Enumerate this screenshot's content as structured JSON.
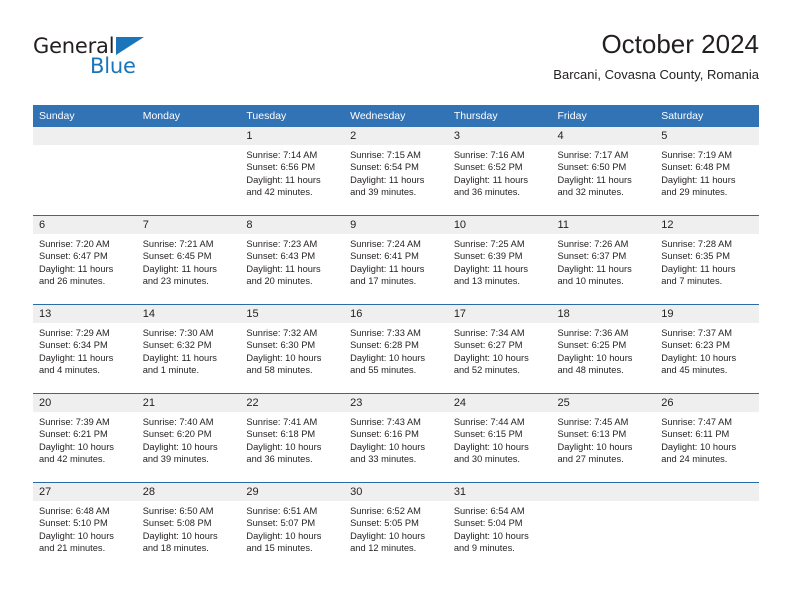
{
  "brand": {
    "name_top": "General",
    "name_bottom": "Blue",
    "color_blue": "#1b75bb",
    "color_dark": "#231f20",
    "triangle_icon": "triangle-icon"
  },
  "header": {
    "title": "October 2024",
    "subtitle": "Barcani, Covasna County, Romania"
  },
  "theme": {
    "header_blue": "#3273b5",
    "row_divider": "#2a6ca8",
    "daynum_bg": "#efefef"
  },
  "weekdays": [
    "Sunday",
    "Monday",
    "Tuesday",
    "Wednesday",
    "Thursday",
    "Friday",
    "Saturday"
  ],
  "weeks": [
    [
      {
        "day": "",
        "sunrise": "",
        "sunset": "",
        "daylight": ""
      },
      {
        "day": "",
        "sunrise": "",
        "sunset": "",
        "daylight": ""
      },
      {
        "day": "1",
        "sunrise": "Sunrise: 7:14 AM",
        "sunset": "Sunset: 6:56 PM",
        "daylight": "Daylight: 11 hours and 42 minutes."
      },
      {
        "day": "2",
        "sunrise": "Sunrise: 7:15 AM",
        "sunset": "Sunset: 6:54 PM",
        "daylight": "Daylight: 11 hours and 39 minutes."
      },
      {
        "day": "3",
        "sunrise": "Sunrise: 7:16 AM",
        "sunset": "Sunset: 6:52 PM",
        "daylight": "Daylight: 11 hours and 36 minutes."
      },
      {
        "day": "4",
        "sunrise": "Sunrise: 7:17 AM",
        "sunset": "Sunset: 6:50 PM",
        "daylight": "Daylight: 11 hours and 32 minutes."
      },
      {
        "day": "5",
        "sunrise": "Sunrise: 7:19 AM",
        "sunset": "Sunset: 6:48 PM",
        "daylight": "Daylight: 11 hours and 29 minutes."
      }
    ],
    [
      {
        "day": "6",
        "sunrise": "Sunrise: 7:20 AM",
        "sunset": "Sunset: 6:47 PM",
        "daylight": "Daylight: 11 hours and 26 minutes."
      },
      {
        "day": "7",
        "sunrise": "Sunrise: 7:21 AM",
        "sunset": "Sunset: 6:45 PM",
        "daylight": "Daylight: 11 hours and 23 minutes."
      },
      {
        "day": "8",
        "sunrise": "Sunrise: 7:23 AM",
        "sunset": "Sunset: 6:43 PM",
        "daylight": "Daylight: 11 hours and 20 minutes."
      },
      {
        "day": "9",
        "sunrise": "Sunrise: 7:24 AM",
        "sunset": "Sunset: 6:41 PM",
        "daylight": "Daylight: 11 hours and 17 minutes."
      },
      {
        "day": "10",
        "sunrise": "Sunrise: 7:25 AM",
        "sunset": "Sunset: 6:39 PM",
        "daylight": "Daylight: 11 hours and 13 minutes."
      },
      {
        "day": "11",
        "sunrise": "Sunrise: 7:26 AM",
        "sunset": "Sunset: 6:37 PM",
        "daylight": "Daylight: 11 hours and 10 minutes."
      },
      {
        "day": "12",
        "sunrise": "Sunrise: 7:28 AM",
        "sunset": "Sunset: 6:35 PM",
        "daylight": "Daylight: 11 hours and 7 minutes."
      }
    ],
    [
      {
        "day": "13",
        "sunrise": "Sunrise: 7:29 AM",
        "sunset": "Sunset: 6:34 PM",
        "daylight": "Daylight: 11 hours and 4 minutes."
      },
      {
        "day": "14",
        "sunrise": "Sunrise: 7:30 AM",
        "sunset": "Sunset: 6:32 PM",
        "daylight": "Daylight: 11 hours and 1 minute."
      },
      {
        "day": "15",
        "sunrise": "Sunrise: 7:32 AM",
        "sunset": "Sunset: 6:30 PM",
        "daylight": "Daylight: 10 hours and 58 minutes."
      },
      {
        "day": "16",
        "sunrise": "Sunrise: 7:33 AM",
        "sunset": "Sunset: 6:28 PM",
        "daylight": "Daylight: 10 hours and 55 minutes."
      },
      {
        "day": "17",
        "sunrise": "Sunrise: 7:34 AM",
        "sunset": "Sunset: 6:27 PM",
        "daylight": "Daylight: 10 hours and 52 minutes."
      },
      {
        "day": "18",
        "sunrise": "Sunrise: 7:36 AM",
        "sunset": "Sunset: 6:25 PM",
        "daylight": "Daylight: 10 hours and 48 minutes."
      },
      {
        "day": "19",
        "sunrise": "Sunrise: 7:37 AM",
        "sunset": "Sunset: 6:23 PM",
        "daylight": "Daylight: 10 hours and 45 minutes."
      }
    ],
    [
      {
        "day": "20",
        "sunrise": "Sunrise: 7:39 AM",
        "sunset": "Sunset: 6:21 PM",
        "daylight": "Daylight: 10 hours and 42 minutes."
      },
      {
        "day": "21",
        "sunrise": "Sunrise: 7:40 AM",
        "sunset": "Sunset: 6:20 PM",
        "daylight": "Daylight: 10 hours and 39 minutes."
      },
      {
        "day": "22",
        "sunrise": "Sunrise: 7:41 AM",
        "sunset": "Sunset: 6:18 PM",
        "daylight": "Daylight: 10 hours and 36 minutes."
      },
      {
        "day": "23",
        "sunrise": "Sunrise: 7:43 AM",
        "sunset": "Sunset: 6:16 PM",
        "daylight": "Daylight: 10 hours and 33 minutes."
      },
      {
        "day": "24",
        "sunrise": "Sunrise: 7:44 AM",
        "sunset": "Sunset: 6:15 PM",
        "daylight": "Daylight: 10 hours and 30 minutes."
      },
      {
        "day": "25",
        "sunrise": "Sunrise: 7:45 AM",
        "sunset": "Sunset: 6:13 PM",
        "daylight": "Daylight: 10 hours and 27 minutes."
      },
      {
        "day": "26",
        "sunrise": "Sunrise: 7:47 AM",
        "sunset": "Sunset: 6:11 PM",
        "daylight": "Daylight: 10 hours and 24 minutes."
      }
    ],
    [
      {
        "day": "27",
        "sunrise": "Sunrise: 6:48 AM",
        "sunset": "Sunset: 5:10 PM",
        "daylight": "Daylight: 10 hours and 21 minutes."
      },
      {
        "day": "28",
        "sunrise": "Sunrise: 6:50 AM",
        "sunset": "Sunset: 5:08 PM",
        "daylight": "Daylight: 10 hours and 18 minutes."
      },
      {
        "day": "29",
        "sunrise": "Sunrise: 6:51 AM",
        "sunset": "Sunset: 5:07 PM",
        "daylight": "Daylight: 10 hours and 15 minutes."
      },
      {
        "day": "30",
        "sunrise": "Sunrise: 6:52 AM",
        "sunset": "Sunset: 5:05 PM",
        "daylight": "Daylight: 10 hours and 12 minutes."
      },
      {
        "day": "31",
        "sunrise": "Sunrise: 6:54 AM",
        "sunset": "Sunset: 5:04 PM",
        "daylight": "Daylight: 10 hours and 9 minutes."
      },
      {
        "day": "",
        "sunrise": "",
        "sunset": "",
        "daylight": ""
      },
      {
        "day": "",
        "sunrise": "",
        "sunset": "",
        "daylight": ""
      }
    ]
  ]
}
